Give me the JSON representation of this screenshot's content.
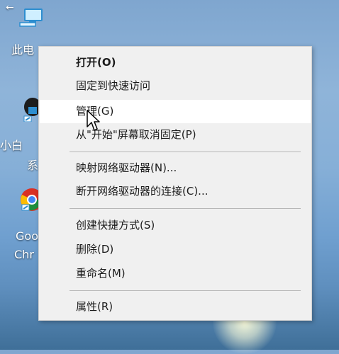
{
  "desktop": {
    "back_glyph": "←",
    "icons": [
      {
        "name": "this-pc",
        "label": "此电",
        "icon": "computer-icon"
      },
      {
        "name": "xiaobai",
        "label_line1": "小白",
        "label_line2": "系",
        "icon": "shortcut-icon"
      },
      {
        "name": "chrome",
        "label_line1": "Goo",
        "label_line2": "Chr",
        "icon": "chrome-icon"
      }
    ]
  },
  "context_menu": {
    "items": [
      {
        "label": "打开(O)",
        "bold": true
      },
      {
        "label": "固定到快速访问",
        "bold": false
      },
      {
        "label": "管理(G)",
        "bold": false,
        "hovered": true
      },
      {
        "label": "从\"开始\"屏幕取消固定(P)",
        "bold": false
      },
      {
        "label": "映射网络驱动器(N)...",
        "bold": false
      },
      {
        "label": "断开网络驱动器的连接(C)...",
        "bold": false
      },
      {
        "label": "创建快捷方式(S)",
        "bold": false
      },
      {
        "label": "删除(D)",
        "bold": false
      },
      {
        "label": "重命名(M)",
        "bold": false
      },
      {
        "label": "属性(R)",
        "bold": false
      }
    ]
  },
  "colors": {
    "menu_background": "#f0f0f0",
    "menu_hover": "#ffffff",
    "menu_text": "#1b1b1b",
    "separator": "#b7b7b7"
  }
}
